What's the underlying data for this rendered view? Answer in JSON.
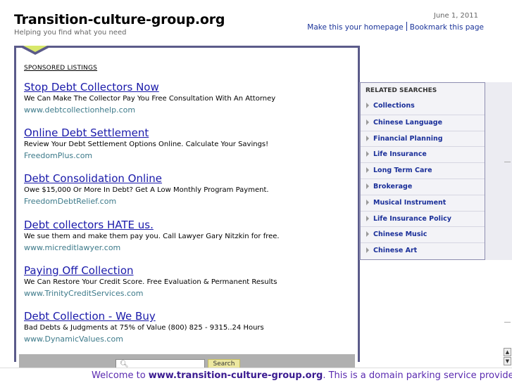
{
  "header": {
    "site_title": "Transition-culture-group.org",
    "tagline": "Helping you find what you need",
    "date": "June 1, 2011",
    "homepage_link": "Make this your homepage",
    "bookmark_link": "Bookmark this page"
  },
  "sponsored_label": "SPONSORED LISTINGS",
  "listings": [
    {
      "title": "Stop Debt Collectors Now",
      "desc": "We Can Make The Collector Pay You Free Consultation With An Attorney",
      "url": "www.debtcollectionhelp.com"
    },
    {
      "title": "Online Debt Settlement",
      "desc": "Review Your Debt Settlement Options Online. Calculate Your Savings!",
      "url": "FreedomPlus.com"
    },
    {
      "title": "Debt Consolidation Online",
      "desc": "Owe $15,000 Or More In Debt? Get A Low Monthly Program Payment.",
      "url": "FreedomDebtRelief.com"
    },
    {
      "title": "Debt collectors HATE us.",
      "desc": "We sue them and make them pay you. Call Lawyer Gary Nitzkin for free.",
      "url": "www.micreditlawyer.com"
    },
    {
      "title": "Paying Off Collection",
      "desc": "We Can Restore Your Credit Score. Free Evaluation & Permanent Results",
      "url": "www.TrinityCreditServices.com"
    },
    {
      "title": "Debt Collection - We Buy",
      "desc": "Bad Debts & Judgments at 75% of Value (800) 825 - 9315..24 Hours",
      "url": "www.DynamicValues.com"
    }
  ],
  "search": {
    "button_label": "Search",
    "placeholder": ""
  },
  "related": {
    "title": "RELATED SEARCHES",
    "items": [
      "Collections",
      "Chinese Language",
      "Financial Planning",
      "Life Insurance",
      "Long Term Care",
      "Brokerage",
      "Musical Instrument",
      "Life Insurance Policy",
      "Chinese Music",
      "Chinese Art"
    ]
  },
  "footer": {
    "prefix": "Welcome to ",
    "domain": "www.transition-culture-group.org",
    "suffix": ". This is a domain parking service provided"
  },
  "colors": {
    "link": "#1a1aaa",
    "url": "#3d7a8a",
    "box_border": "#5b5b8a",
    "footer_text": "#5a2ab0"
  }
}
